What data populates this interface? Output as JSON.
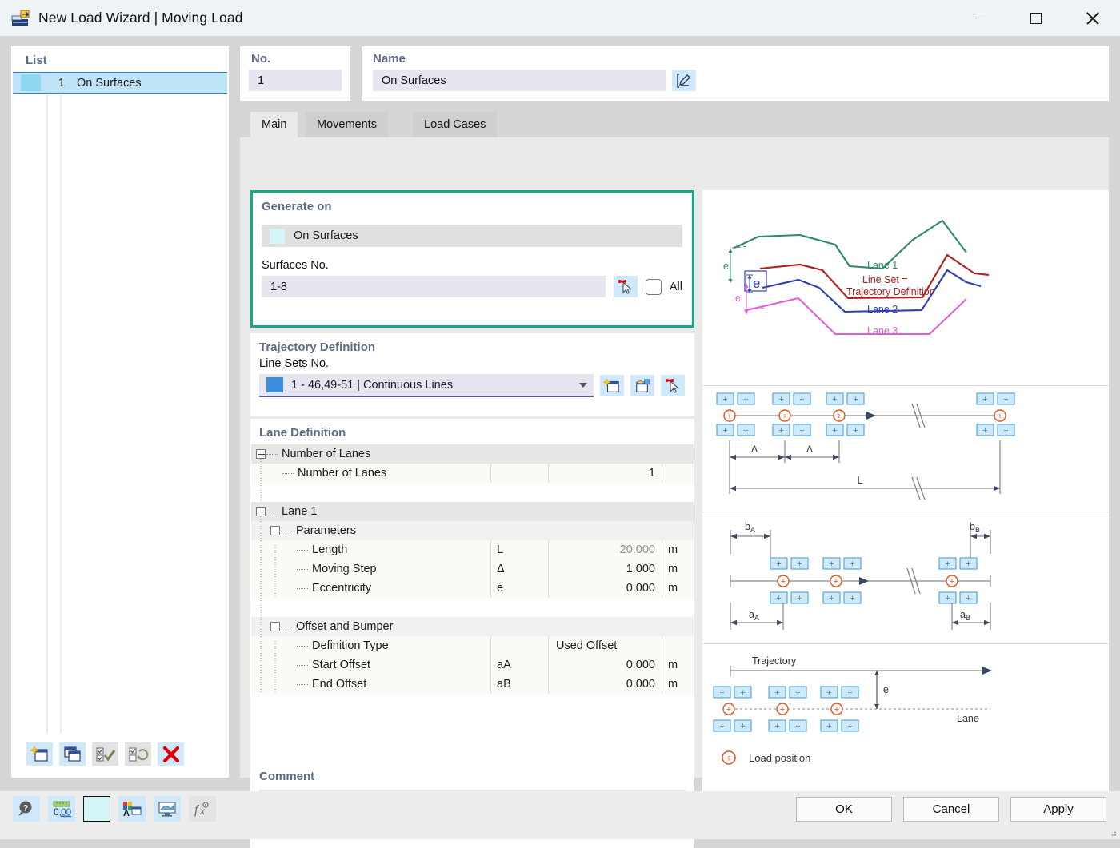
{
  "window": {
    "title": "New Load Wizard | Moving Load",
    "app_icon": "moving-load-icon",
    "minimize": "minimize-icon",
    "maximize": "maximize-icon",
    "close": "close-icon"
  },
  "list_panel": {
    "header": "List",
    "rows": [
      {
        "index": "1",
        "label": "On Surfaces",
        "color": "#8fd8f2"
      }
    ],
    "toolbar": [
      {
        "name": "new-item-button",
        "icon": "new-window-icon"
      },
      {
        "name": "copy-item-button",
        "icon": "copy-window-icon"
      },
      {
        "name": "select-all-button",
        "icon": "check-all-icon"
      },
      {
        "name": "invert-selection-button",
        "icon": "invert-selection-icon"
      },
      {
        "name": "delete-item-button",
        "icon": "red-x-icon"
      }
    ]
  },
  "header": {
    "no_label": "No.",
    "no_value": "1",
    "name_label": "Name",
    "name_value": "On Surfaces",
    "name_edit_icon": "edit-pencil-icon"
  },
  "tabs": [
    {
      "label": "Main",
      "active": true
    },
    {
      "label": "Movements",
      "active": false
    },
    {
      "label": "Load Cases",
      "active": false
    }
  ],
  "generate_on": {
    "title": "Generate on",
    "selected_item": "On Surfaces",
    "selected_item_color": "#d4f6f7",
    "surfaces_label": "Surfaces No.",
    "surfaces_value": "1-8",
    "pick_icon": "pick-deselect-cursor-icon",
    "all_checkbox_label": "All",
    "all_checked": false,
    "highlight_color": "#12ab85"
  },
  "trajectory": {
    "title": "Trajectory Definition",
    "line_sets_label": "Line Sets No.",
    "line_sets_value": "1 - 46,49-51 | Continuous Lines",
    "line_sets_color": "#3a8ede",
    "buttons": [
      {
        "name": "new-line-set-button",
        "icon": "new-window-star-icon"
      },
      {
        "name": "edit-line-set-button",
        "icon": "edit-window-hand-icon"
      },
      {
        "name": "delete-line-set-button",
        "icon": "delete-cursor-red-x-icon"
      }
    ]
  },
  "lane_definition": {
    "title": "Lane Definition",
    "rows": [
      {
        "kind": "group",
        "indent": 0,
        "name": "Number of Lanes",
        "symbol": "",
        "value": "",
        "unit": ""
      },
      {
        "kind": "data",
        "indent": 1,
        "name": "Number of Lanes",
        "symbol": "",
        "value": "1",
        "unit": ""
      },
      {
        "kind": "spacer",
        "indent": 0,
        "name": "",
        "symbol": "",
        "value": "",
        "unit": ""
      },
      {
        "kind": "group",
        "indent": 0,
        "name": "Lane 1",
        "symbol": "",
        "value": "",
        "unit": ""
      },
      {
        "kind": "subgroup",
        "indent": 1,
        "name": "Parameters",
        "symbol": "",
        "value": "",
        "unit": ""
      },
      {
        "kind": "data",
        "indent": 2,
        "name": "Length",
        "symbol": "L",
        "value": "20.000",
        "unit": "m",
        "readonly": true
      },
      {
        "kind": "data",
        "indent": 2,
        "name": "Moving Step",
        "symbol": "Δ",
        "value": "1.000",
        "unit": "m"
      },
      {
        "kind": "data",
        "indent": 2,
        "name": "Eccentricity",
        "symbol": "e",
        "value": "0.000",
        "unit": "m"
      },
      {
        "kind": "spacer",
        "indent": 0,
        "name": "",
        "symbol": "",
        "value": "",
        "unit": ""
      },
      {
        "kind": "subgroup",
        "indent": 1,
        "name": "Offset and Bumper",
        "symbol": "",
        "value": "",
        "unit": ""
      },
      {
        "kind": "data",
        "indent": 2,
        "name": "Definition Type",
        "symbol": "",
        "value": "Used Offset",
        "unit": "",
        "value_align": "left"
      },
      {
        "kind": "data",
        "indent": 2,
        "name": "Start Offset",
        "symbol": "aA",
        "value": "0.000",
        "unit": "m"
      },
      {
        "kind": "data",
        "indent": 2,
        "name": "End Offset",
        "symbol": "aB",
        "value": "0.000",
        "unit": "m"
      }
    ]
  },
  "comment": {
    "title": "Comment",
    "value": "",
    "placeholder": ""
  },
  "graphic": {
    "lanes_diagram": {
      "lane1_label": "Lane 1",
      "lane1_color": "#2e8b68",
      "lane2_label": "Lane 2",
      "lane2_color": "#2b3fb0",
      "lane3_label": "Lane 3",
      "lane3_color": "#e05fd9",
      "line_set_label_1": "Line Set =",
      "line_set_label_2": "Trajectory Definition",
      "line_set_color": "#b01f1f",
      "e_labels": [
        "e",
        "e",
        "e"
      ]
    },
    "step_diagram": {
      "delta_label": "Δ",
      "length_label": "L"
    },
    "offset_diagram": {
      "bA_label": "b",
      "bA_sub": "A",
      "bB_label": "b",
      "bB_sub": "B",
      "aA_label": "a",
      "aA_sub": "A",
      "aB_label": "a",
      "aB_sub": "B"
    },
    "eccentricity_diagram": {
      "trajectory_label": "Trajectory",
      "lane_label": "Lane",
      "e_label": "e"
    },
    "legend": {
      "load_position_label": "Load position",
      "marker_color": "#e0541d"
    }
  },
  "footer": {
    "tools": [
      {
        "name": "help-button",
        "icon": "help-magnifier-icon"
      },
      {
        "name": "decimal-places-button",
        "icon": "decimal-ruler-icon"
      },
      {
        "name": "color-swatch-button",
        "icon": "color-swatch-icon",
        "color": "#d4f6f7"
      },
      {
        "name": "display-properties-button",
        "icon": "color-font-window-icon"
      },
      {
        "name": "visibility-button",
        "icon": "monitor-surface-icon"
      },
      {
        "name": "formula-button",
        "icon": "fx-formula-icon"
      }
    ],
    "ok_label": "OK",
    "cancel_label": "Cancel",
    "apply_label": "Apply"
  }
}
